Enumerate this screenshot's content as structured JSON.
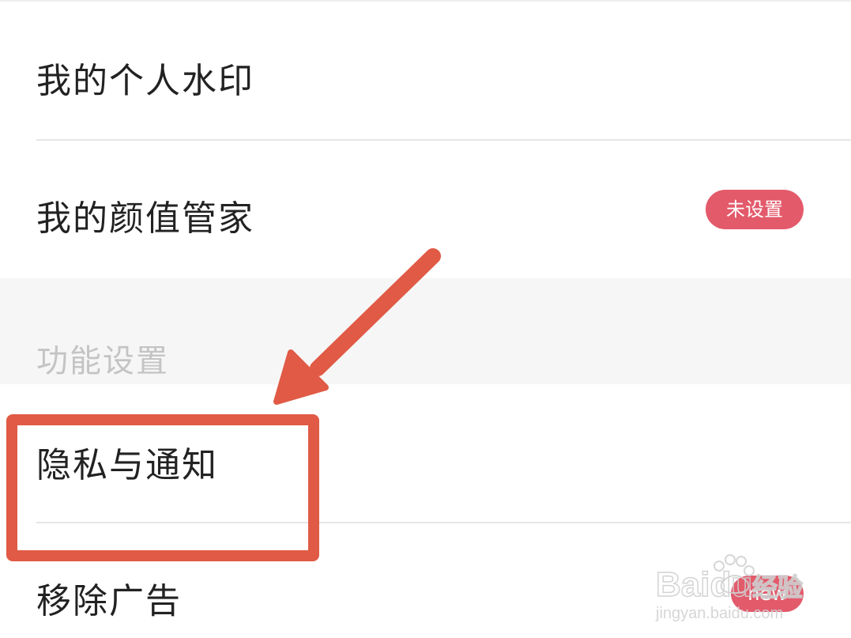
{
  "settings": {
    "items": [
      {
        "label": "我的个人水印"
      },
      {
        "label": "我的颜值管家",
        "badge": "未设置"
      },
      {
        "label": "隐私与通知"
      },
      {
        "label": "移除广告",
        "badge": "new"
      }
    ],
    "section_title": "功能设置"
  },
  "watermark": {
    "brand": "Baidu",
    "brand_cn": "经验",
    "url": "jingyan.baidu.com"
  },
  "colors": {
    "badge": "#e35a6b",
    "annotation": "#e05a45"
  }
}
